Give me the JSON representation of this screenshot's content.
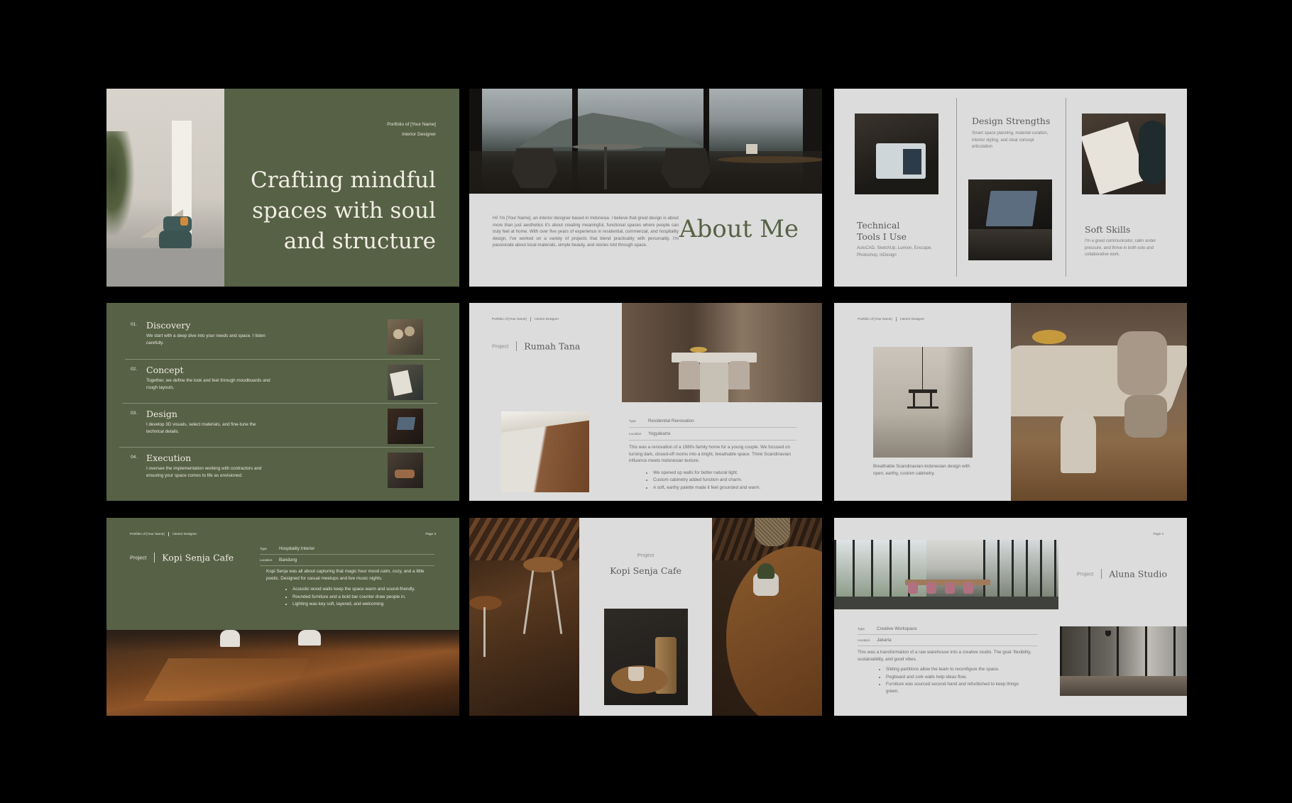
{
  "cover": {
    "portfolio_of": "Portfolio of [Your Name]",
    "role": "Interior Designer",
    "headline_l1": "Crafting mindful",
    "headline_l2": "spaces with soul",
    "headline_l3": "and structure"
  },
  "about": {
    "title": "About Me",
    "body": "Hi! I'm [Your Name], an interior designer based in Indonesia. I believe that great design is about more than just aesthetics it's about creating meaningful, functional spaces where people can truly feel at home. With over five years of experience in residential, commercial, and hospitality design, I've worked on a variety of projects that blend practicality with personality. I'm passionate about local materials, simple beauty, and stories told through space."
  },
  "strengths": {
    "design_title": "Design Strengths",
    "design_body": "Smart space planning, material curation, interior styling, and clear concept articulation",
    "tools_title_l1": "Technical",
    "tools_title_l2": "Tools I Use",
    "tools_body": "AutoCAD, SketchUp, Lumion, Enscape, Photoshop, InDesign",
    "soft_title": "Soft Skills",
    "soft_body": "I'm a great communicator, calm under pressure, and thrive in both solo and collaborative work."
  },
  "process": {
    "steps": [
      {
        "num": "01.",
        "title": "Discovery",
        "desc": "We start with a deep dive into your needs and space. I listen carefully."
      },
      {
        "num": "02.",
        "title": "Concept",
        "desc": "Together, we define the look and feel through moodboards and rough layouts."
      },
      {
        "num": "03.",
        "title": "Design",
        "desc": "I develop 3D visuals, select materials, and fine-tune the technical details."
      },
      {
        "num": "04.",
        "title": "Execution",
        "desc": "I oversee the implementation working with contractors and ensuring your space comes to life as envisioned."
      }
    ]
  },
  "rumah": {
    "header_name": "Portfolio of [Your Name]",
    "header_role": "Interior Designer",
    "project_label": "Project",
    "project_name": "Rumah Tana",
    "type_label": "Type",
    "type_value": "Residential Renovation",
    "location_label": "Location",
    "location_value": "Yogyakarta",
    "desc": "This was a renovation of a 1980s family home for a young couple. We focused on turning dark, closed-off rooms into a bright, breathable space. Think Scandinavian influence meets Indonesian texture.",
    "bullets": [
      "We opened up walls for better natural light.",
      "Custom cabinetry added function and charm.",
      "A soft, earthy palette made it feel grounded and warm."
    ]
  },
  "rumah2": {
    "header_name": "Portfolio of [Your Name]",
    "header_role": "Interior Designer",
    "caption": "Breathable Scandinavian-Indonesian design with open, earthy, custom cabinetry."
  },
  "kopi": {
    "header_name": "Portfolio of [Your Name]",
    "header_role": "Interior Designer",
    "page": "Page 3",
    "project_label": "Project",
    "project_name": "Kopi Senja Cafe",
    "type_label": "Type",
    "type_value": "Hospitality Interior",
    "location_label": "Location",
    "location_value": "Bandung",
    "desc": "Kopi Senja was all about capturing that magic hour mood calm, cozy, and a little poetic. Designed for casual meetups and live music nights.",
    "bullets": [
      "Acoustic wood walls keep the space warm and sound-friendly.",
      "Rounded furniture and a bold bar counter draw people in.",
      "Lighting was key soft, layered, and welcoming."
    ]
  },
  "kopi2": {
    "project_label": "Project",
    "project_name": "Kopi Senja Cafe"
  },
  "aluna": {
    "page": "Page 4",
    "project_label": "Project",
    "project_name": "Aluna Studio",
    "type_label": "Type",
    "type_value": "Creative Workspace",
    "location_label": "Location",
    "location_value": "Jakarta",
    "desc": "This was a transformation of a raw warehouse into a creative studio. The goal: flexibility, sustainability, and good vibes.",
    "bullets": [
      "Sliding partitions allow the team to reconfigure the space.",
      "Pegboard and cork walls help ideas flow.",
      "Furniture was sourced second-hand and refurbished to keep things green."
    ]
  }
}
